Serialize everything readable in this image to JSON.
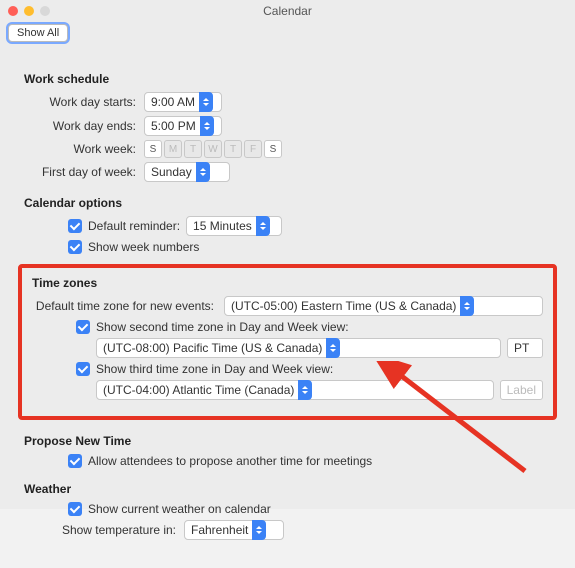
{
  "window": {
    "title": "Calendar",
    "show_all": "Show All"
  },
  "work_schedule": {
    "title": "Work schedule",
    "starts_label": "Work day starts:",
    "starts_value": "9:00 AM",
    "ends_label": "Work day ends:",
    "ends_value": "5:00 PM",
    "week_label": "Work week:",
    "days": [
      "S",
      "M",
      "T",
      "W",
      "T",
      "F",
      "S"
    ],
    "first_day_label": "First day of week:",
    "first_day_value": "Sunday"
  },
  "calendar_options": {
    "title": "Calendar options",
    "default_reminder_label": "Default reminder:",
    "default_reminder_value": "15 Minutes",
    "show_week_numbers": "Show week numbers"
  },
  "time_zones": {
    "title": "Time zones",
    "default_label": "Default time zone for new events:",
    "default_value": "(UTC-05:00) Eastern Time (US & Canada)",
    "second_check": "Show second time zone in Day and Week view:",
    "second_value": "(UTC-08:00) Pacific Time (US & Canada)",
    "second_tag": "PT",
    "third_check": "Show third time zone in Day and Week view:",
    "third_value": "(UTC-04:00) Atlantic Time (Canada)",
    "third_tag_placeholder": "Label"
  },
  "propose": {
    "title": "Propose New Time",
    "allow": "Allow attendees to propose another time for meetings"
  },
  "weather": {
    "title": "Weather",
    "show": "Show current weather on calendar",
    "temp_label": "Show temperature in:",
    "temp_value": "Fahrenheit"
  }
}
